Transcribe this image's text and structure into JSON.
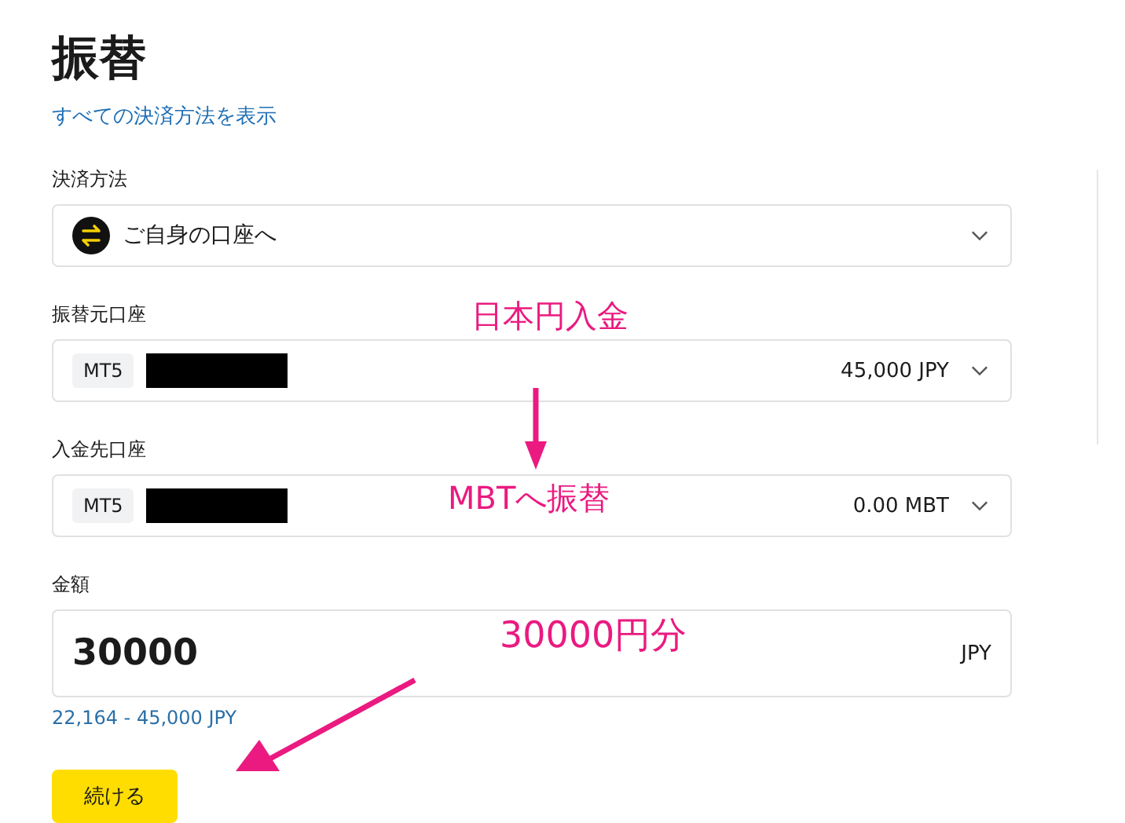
{
  "title": "振替",
  "all_methods_link": "すべての決済方法を表示",
  "fields": [
    {
      "kind": "method",
      "label": "決済方法",
      "value": "ご自身の口座へ"
    },
    {
      "kind": "account",
      "label": "振替元口座",
      "platform": "MT5",
      "balance": "45,000 JPY"
    },
    {
      "kind": "account",
      "label": "入金先口座",
      "platform": "MT5",
      "balance": "0.00 MBT"
    },
    {
      "kind": "amount",
      "label": "金額",
      "value": "30000",
      "currency": "JPY",
      "range": "22,164 - 45,000 JPY"
    }
  ],
  "continue_button": "続ける",
  "annotations": [
    "日本円入金",
    "MBTへ振替",
    "30000円分"
  ]
}
